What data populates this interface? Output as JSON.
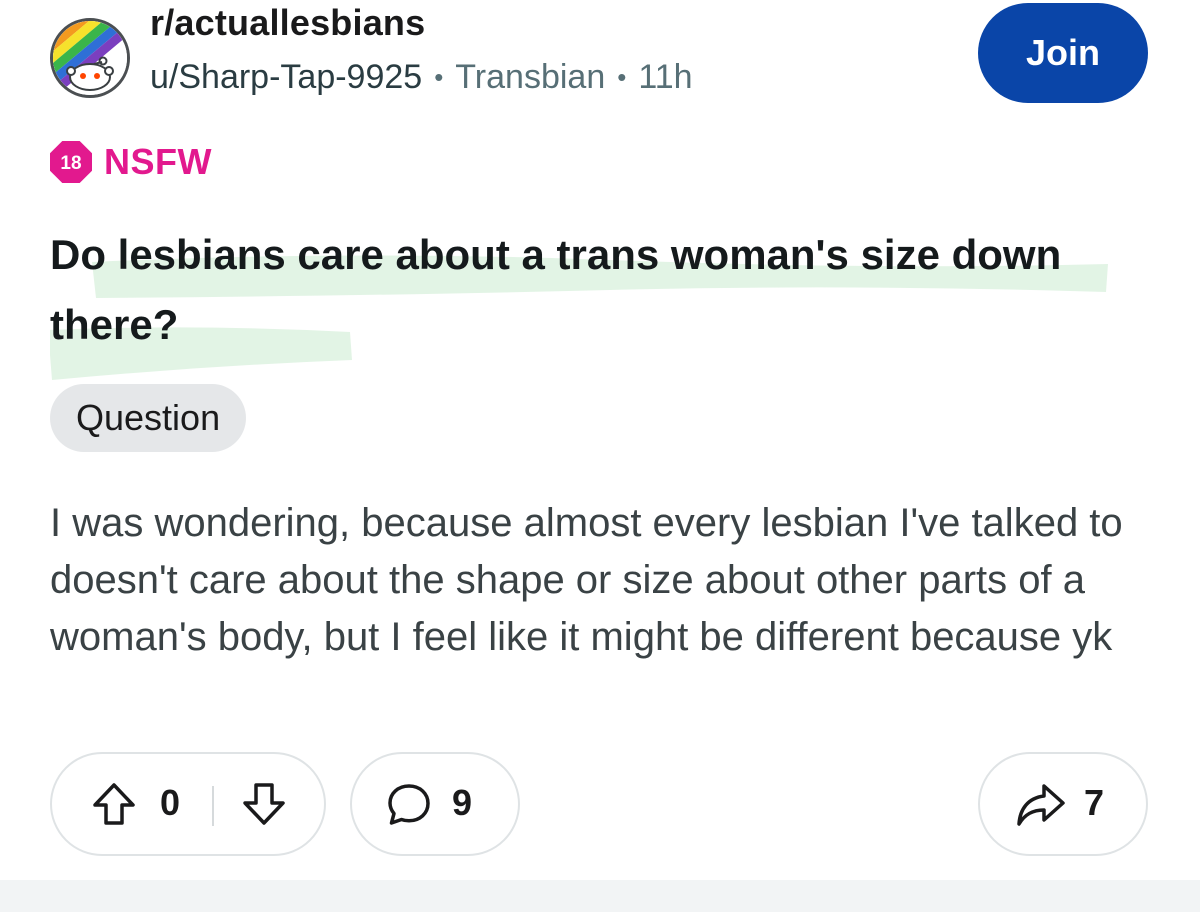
{
  "header": {
    "subreddit": "r/actuallesbians",
    "username": "u/Sharp-Tap-9925",
    "separator": "•",
    "user_flair": "Transbian",
    "time_ago": "11h",
    "join_label": "Join"
  },
  "nsfw": {
    "badge_text": "18",
    "label": "NSFW"
  },
  "post": {
    "title": "Do lesbians care about a trans woman's size down there?",
    "flair": "Question",
    "body": "I was wondering, because almost every lesbian I've talked to doesn't care about the shape or size about other parts of a woman's body, but I feel like it might be different because yk"
  },
  "actions": {
    "vote_count": "0",
    "comment_count": "9",
    "share_count": "7"
  },
  "icons": {
    "avatar": "subreddit-rainbow-avatar-icon",
    "upvote": "arrow-up-icon",
    "downvote": "arrow-down-icon",
    "comment": "speech-bubble-icon",
    "share": "share-arrow-icon"
  },
  "colors": {
    "join_button": "#0a45a8",
    "nsfw": "#e2198e",
    "flair_bg": "#e5e7e9",
    "highlight": "#dff3e2"
  }
}
